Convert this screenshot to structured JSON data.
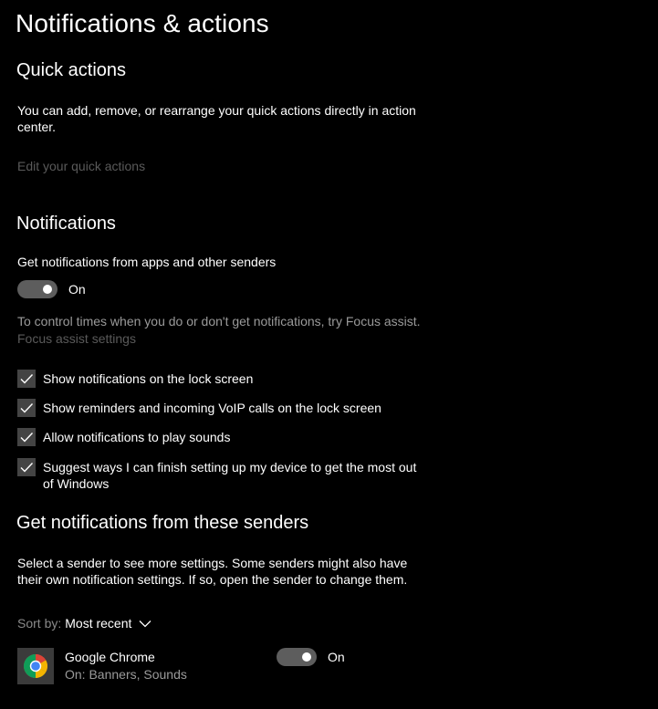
{
  "page": {
    "title": "Notifications & actions"
  },
  "quick_actions": {
    "heading": "Quick actions",
    "description": "You can add, remove, or rearrange your quick actions directly in action center.",
    "edit_link": "Edit your quick actions"
  },
  "notifications": {
    "heading": "Notifications",
    "get_notifications_label": "Get notifications from apps and other senders",
    "toggle_state": "On",
    "focus_hint": "To control times when you do or don't get notifications, try Focus assist.",
    "focus_link": "Focus assist settings",
    "options": [
      {
        "label": "Show notifications on the lock screen",
        "checked": true
      },
      {
        "label": "Show reminders and incoming VoIP calls on the lock screen",
        "checked": true
      },
      {
        "label": "Allow notifications to play sounds",
        "checked": true
      },
      {
        "label": "Suggest ways I can finish setting up my device to get the most out of Windows",
        "checked": true
      }
    ]
  },
  "senders": {
    "heading": "Get notifications from these senders",
    "description": "Select a sender to see more settings. Some senders might also have their own notification settings. If so, open the sender to change them.",
    "sort_prefix": "Sort by:",
    "sort_value": "Most recent",
    "apps": [
      {
        "name": "Google Chrome",
        "status": "On: Banners, Sounds",
        "toggle_state": "On",
        "icon": "chrome-icon"
      }
    ]
  },
  "colors": {
    "background": "#000000",
    "text": "#ffffff",
    "muted_link": "#5a5a5a",
    "secondary_text": "#9a9a9a",
    "toggle_track": "#5d5d5d",
    "checkbox": "#444444"
  }
}
